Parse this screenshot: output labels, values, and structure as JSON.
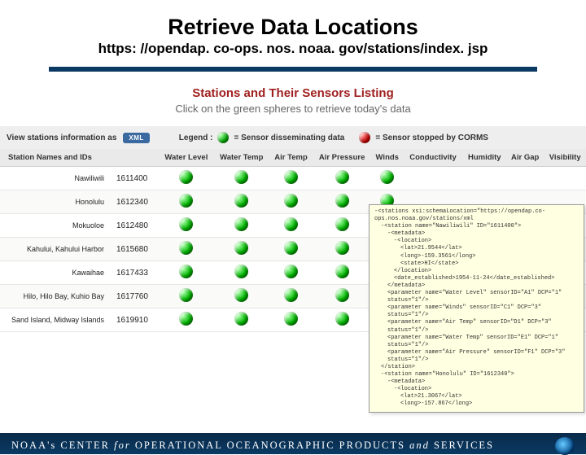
{
  "title": "Retrieve Data Locations",
  "url": "https: //opendap. co-ops. nos. noaa. gov/stations/index. jsp",
  "listing": {
    "heading": "Stations and Their Sensors Listing",
    "subheading": "Click on the green spheres to retrieve today's data"
  },
  "header": {
    "viewAs": "View stations information as",
    "xmlBadge": "XML",
    "legendLabel": "Legend :",
    "legendGreen": "= Sensor disseminating data",
    "legendRed": "= Sensor stopped by CORMS"
  },
  "columns": [
    "Station Names and IDs",
    "Water Level",
    "Water Temp",
    "Air Temp",
    "Air Pressure",
    "Winds",
    "Conductivity",
    "Humidity",
    "Air Gap",
    "Visibility"
  ],
  "rows": [
    {
      "name": "Nawiliwili",
      "id": "1611400",
      "sensors": [
        1,
        1,
        1,
        1,
        1,
        0,
        0,
        0,
        0
      ]
    },
    {
      "name": "Honolulu",
      "id": "1612340",
      "sensors": [
        1,
        1,
        1,
        1,
        1,
        0,
        0,
        0,
        0
      ]
    },
    {
      "name": "Mokuoloe",
      "id": "1612480",
      "sensors": [
        1,
        1,
        1,
        1,
        0,
        0,
        0,
        0,
        0
      ]
    },
    {
      "name": "Kahului, Kahului Harbor",
      "id": "1615680",
      "sensors": [
        1,
        1,
        1,
        1,
        1,
        0,
        0,
        0,
        0
      ]
    },
    {
      "name": "Kawaihae",
      "id": "1617433",
      "sensors": [
        1,
        1,
        1,
        1,
        1,
        0,
        0,
        0,
        0
      ]
    },
    {
      "name": "Hilo, Hilo Bay, Kuhio Bay",
      "id": "1617760",
      "sensors": [
        1,
        1,
        1,
        1,
        1,
        0,
        0,
        0,
        0
      ]
    },
    {
      "name": "Sand Island, Midway Islands",
      "id": "1619910",
      "sensors": [
        1,
        1,
        1,
        1,
        1,
        0,
        0,
        0,
        0
      ]
    }
  ],
  "xml": {
    "l0": "-<stations xsi:schemaLocation=\"https://opendap.co-ops.nos.noaa.gov/stations/xml",
    "l1": "-<station name=\"Nawiliwili\" ID=\"1611400\">",
    "l2": "-<metadata>",
    "l3": "-<location>",
    "l4": "<lat>21.9544</lat>",
    "l5": "<long>-159.3561</long>",
    "l6": "<state>HI</state>",
    "l7": "</location>",
    "l8": "<date_established>1954-11-24</date_established>",
    "l9": "</metadata>",
    "p1": "<parameter name=\"Water Level\" sensorID=\"A1\" DCP=\"1\" status=\"1\"/>",
    "p2": "<parameter name=\"Winds\" sensorID=\"C1\" DCP=\"3\" status=\"1\"/>",
    "p3": "<parameter name=\"Air Temp\" sensorID=\"D1\" DCP=\"3\" status=\"1\"/>",
    "p4": "<parameter name=\"Water Temp\" sensorID=\"E1\" DCP=\"1\" status=\"1\"/>",
    "p5": "<parameter name=\"Air Pressure\" sensorID=\"F1\" DCP=\"3\" status=\"1\"/>",
    "l10": "</station>",
    "l11": "-<station name=\"Honolulu\" ID=\"1612340\">",
    "l12": "-<metadata>",
    "l13": "-<location>",
    "l14": "<lat>21.3067</lat>",
    "l15": "<long>-157.867</long>"
  },
  "footer": {
    "text1": "NOAA's",
    "text2": "CENTER",
    "text3": "for",
    "text4": "OPERATIONAL",
    "text5": "OCEANOGRAPHIC",
    "text6": "PRODUCTS",
    "text7": "and",
    "text8": "SERVICES"
  }
}
